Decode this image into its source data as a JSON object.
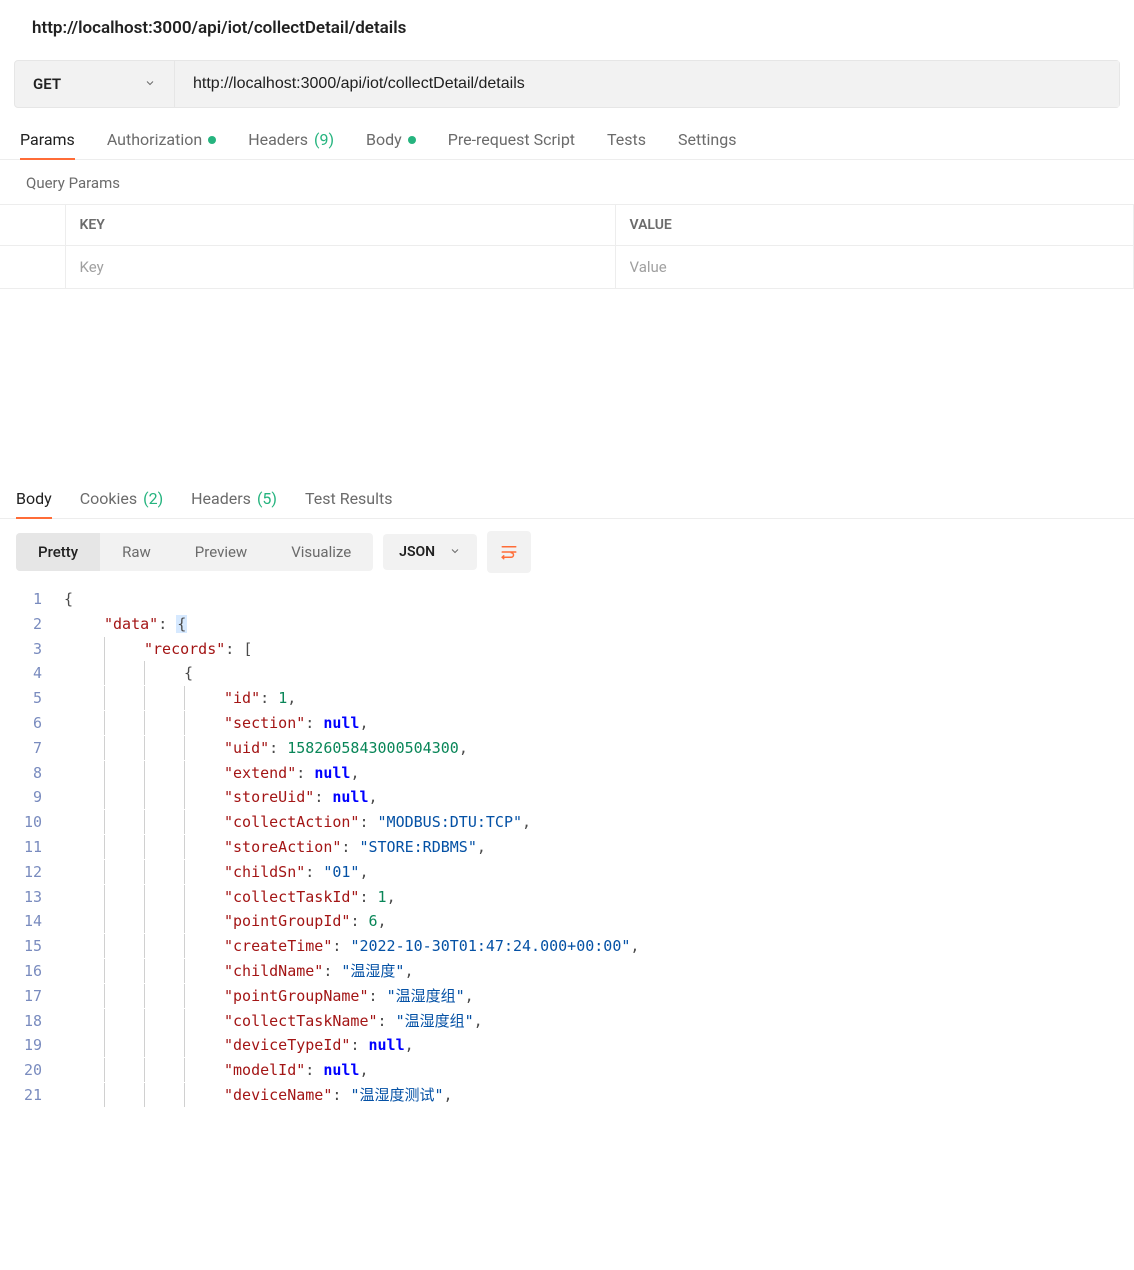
{
  "title": "http://localhost:3000/api/iot/collectDetail/details",
  "request": {
    "method": "GET",
    "url": "http://localhost:3000/api/iot/collectDetail/details"
  },
  "requestTabs": [
    {
      "label": "Params",
      "active": true
    },
    {
      "label": "Authorization",
      "dot": true
    },
    {
      "label": "Headers",
      "count": "(9)"
    },
    {
      "label": "Body",
      "dot": true
    },
    {
      "label": "Pre-request Script"
    },
    {
      "label": "Tests"
    },
    {
      "label": "Settings"
    }
  ],
  "queryParamsHeading": "Query Params",
  "paramsTable": {
    "headers": {
      "key": "KEY",
      "value": "VALUE"
    },
    "placeholders": {
      "key": "Key",
      "value": "Value"
    }
  },
  "responseTabs": [
    {
      "label": "Body",
      "active": true
    },
    {
      "label": "Cookies",
      "count": "(2)"
    },
    {
      "label": "Headers",
      "count": "(5)"
    },
    {
      "label": "Test Results"
    }
  ],
  "viewModes": [
    {
      "label": "Pretty",
      "active": true
    },
    {
      "label": "Raw"
    },
    {
      "label": "Preview"
    },
    {
      "label": "Visualize"
    }
  ],
  "formatSelect": "JSON",
  "code": {
    "lineNumbers": [
      1,
      2,
      3,
      4,
      5,
      6,
      7,
      8,
      9,
      10,
      11,
      12,
      13,
      14,
      15,
      16,
      17,
      18,
      19,
      20,
      21
    ],
    "lines": [
      {
        "indent": 0,
        "tokens": [
          {
            "t": "punc",
            "v": "{"
          }
        ]
      },
      {
        "indent": 1,
        "tokens": [
          {
            "t": "key",
            "v": "\"data\""
          },
          {
            "t": "punc",
            "v": ": "
          },
          {
            "t": "hlbrace",
            "v": "{"
          }
        ]
      },
      {
        "indent": 2,
        "tokens": [
          {
            "t": "key",
            "v": "\"records\""
          },
          {
            "t": "punc",
            "v": ": ["
          }
        ]
      },
      {
        "indent": 3,
        "tokens": [
          {
            "t": "punc",
            "v": "{"
          }
        ]
      },
      {
        "indent": 4,
        "tokens": [
          {
            "t": "key",
            "v": "\"id\""
          },
          {
            "t": "punc",
            "v": ": "
          },
          {
            "t": "num",
            "v": "1"
          },
          {
            "t": "punc",
            "v": ","
          }
        ]
      },
      {
        "indent": 4,
        "tokens": [
          {
            "t": "key",
            "v": "\"section\""
          },
          {
            "t": "punc",
            "v": ": "
          },
          {
            "t": "null",
            "v": "null"
          },
          {
            "t": "punc",
            "v": ","
          }
        ]
      },
      {
        "indent": 4,
        "tokens": [
          {
            "t": "key",
            "v": "\"uid\""
          },
          {
            "t": "punc",
            "v": ": "
          },
          {
            "t": "num",
            "v": "1582605843000504300"
          },
          {
            "t": "punc",
            "v": ","
          }
        ]
      },
      {
        "indent": 4,
        "tokens": [
          {
            "t": "key",
            "v": "\"extend\""
          },
          {
            "t": "punc",
            "v": ": "
          },
          {
            "t": "null",
            "v": "null"
          },
          {
            "t": "punc",
            "v": ","
          }
        ]
      },
      {
        "indent": 4,
        "tokens": [
          {
            "t": "key",
            "v": "\"storeUid\""
          },
          {
            "t": "punc",
            "v": ": "
          },
          {
            "t": "null",
            "v": "null"
          },
          {
            "t": "punc",
            "v": ","
          }
        ]
      },
      {
        "indent": 4,
        "tokens": [
          {
            "t": "key",
            "v": "\"collectAction\""
          },
          {
            "t": "punc",
            "v": ": "
          },
          {
            "t": "str",
            "v": "\"MODBUS:DTU:TCP\""
          },
          {
            "t": "punc",
            "v": ","
          }
        ]
      },
      {
        "indent": 4,
        "tokens": [
          {
            "t": "key",
            "v": "\"storeAction\""
          },
          {
            "t": "punc",
            "v": ": "
          },
          {
            "t": "str",
            "v": "\"STORE:RDBMS\""
          },
          {
            "t": "punc",
            "v": ","
          }
        ]
      },
      {
        "indent": 4,
        "tokens": [
          {
            "t": "key",
            "v": "\"childSn\""
          },
          {
            "t": "punc",
            "v": ": "
          },
          {
            "t": "str",
            "v": "\"01\""
          },
          {
            "t": "punc",
            "v": ","
          }
        ]
      },
      {
        "indent": 4,
        "tokens": [
          {
            "t": "key",
            "v": "\"collectTaskId\""
          },
          {
            "t": "punc",
            "v": ": "
          },
          {
            "t": "num",
            "v": "1"
          },
          {
            "t": "punc",
            "v": ","
          }
        ]
      },
      {
        "indent": 4,
        "tokens": [
          {
            "t": "key",
            "v": "\"pointGroupId\""
          },
          {
            "t": "punc",
            "v": ": "
          },
          {
            "t": "num",
            "v": "6"
          },
          {
            "t": "punc",
            "v": ","
          }
        ]
      },
      {
        "indent": 4,
        "tokens": [
          {
            "t": "key",
            "v": "\"createTime\""
          },
          {
            "t": "punc",
            "v": ": "
          },
          {
            "t": "str",
            "v": "\"2022-10-30T01:47:24.000+00:00\""
          },
          {
            "t": "punc",
            "v": ","
          }
        ]
      },
      {
        "indent": 4,
        "tokens": [
          {
            "t": "key",
            "v": "\"childName\""
          },
          {
            "t": "punc",
            "v": ": "
          },
          {
            "t": "str",
            "v": "\"温湿度\""
          },
          {
            "t": "punc",
            "v": ","
          }
        ]
      },
      {
        "indent": 4,
        "tokens": [
          {
            "t": "key",
            "v": "\"pointGroupName\""
          },
          {
            "t": "punc",
            "v": ": "
          },
          {
            "t": "str",
            "v": "\"温湿度组\""
          },
          {
            "t": "punc",
            "v": ","
          }
        ]
      },
      {
        "indent": 4,
        "tokens": [
          {
            "t": "key",
            "v": "\"collectTaskName\""
          },
          {
            "t": "punc",
            "v": ": "
          },
          {
            "t": "str",
            "v": "\"温湿度组\""
          },
          {
            "t": "punc",
            "v": ","
          }
        ]
      },
      {
        "indent": 4,
        "tokens": [
          {
            "t": "key",
            "v": "\"deviceTypeId\""
          },
          {
            "t": "punc",
            "v": ": "
          },
          {
            "t": "null",
            "v": "null"
          },
          {
            "t": "punc",
            "v": ","
          }
        ]
      },
      {
        "indent": 4,
        "tokens": [
          {
            "t": "key",
            "v": "\"modelId\""
          },
          {
            "t": "punc",
            "v": ": "
          },
          {
            "t": "null",
            "v": "null"
          },
          {
            "t": "punc",
            "v": ","
          }
        ]
      },
      {
        "indent": 4,
        "tokens": [
          {
            "t": "key",
            "v": "\"deviceName\""
          },
          {
            "t": "punc",
            "v": ": "
          },
          {
            "t": "str",
            "v": "\"温湿度测试\""
          },
          {
            "t": "punc",
            "v": ","
          }
        ]
      }
    ]
  }
}
